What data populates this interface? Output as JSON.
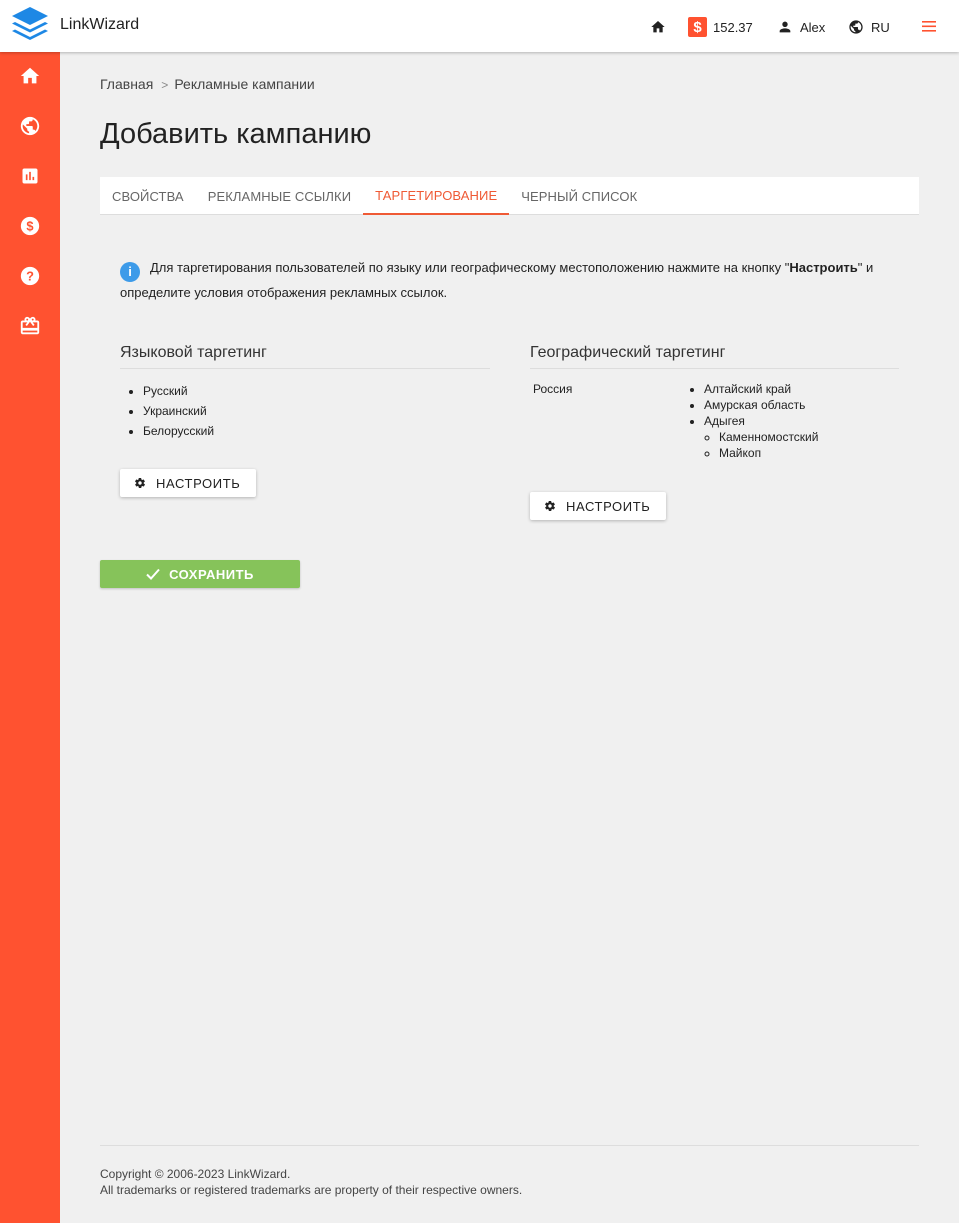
{
  "app": {
    "name": "LinkWizard"
  },
  "topbar": {
    "balance": "152.37",
    "currency_symbol": "$",
    "user": "Alex",
    "language": "RU",
    "accent": "#ff5230"
  },
  "sidebar": {
    "items": [
      {
        "icon": "home-icon"
      },
      {
        "icon": "globe-icon"
      },
      {
        "icon": "bar-chart-icon"
      },
      {
        "icon": "dollar-icon"
      },
      {
        "icon": "help-icon"
      },
      {
        "icon": "gift-icon"
      }
    ]
  },
  "breadcrumb": {
    "home": "Главная",
    "separator": ">",
    "current": "Рекламные кампании"
  },
  "page_title": "Добавить кампанию",
  "tabs": [
    {
      "label": "СВОЙСТВА",
      "active": false
    },
    {
      "label": "РЕКЛАМНЫЕ ССЫЛКИ",
      "active": false
    },
    {
      "label": "ТАРГЕТИРОВАНИЕ",
      "active": true
    },
    {
      "label": "ЧЕРНЫЙ СПИСОК",
      "active": false
    }
  ],
  "info": {
    "text_before": "Для таргетирования пользователей по языку или географическому местоположению нажмите на кнопку \"",
    "bold": "Настроить",
    "text_after": "\" и определите условия отображения рекламных ссылок."
  },
  "language_targeting": {
    "title": "Языковой таргетинг",
    "items": [
      "Русский",
      "Украинский",
      "Белорусский"
    ],
    "button": "НАСТРОИТЬ"
  },
  "geo_targeting": {
    "title": "Географический таргетинг",
    "country": "Россия",
    "regions": [
      "Алтайский край",
      "Амурская область",
      "Адыгея"
    ],
    "cities": [
      "Каменномостский",
      "Майкоп"
    ],
    "button": "НАСТРОИТЬ"
  },
  "save_button": "СОХРАНИТЬ",
  "footer": {
    "copyright": "Copyright © 2006-2023 LinkWizard.",
    "trademarks": "All trademarks or registered trademarks are property of their respective owners."
  }
}
